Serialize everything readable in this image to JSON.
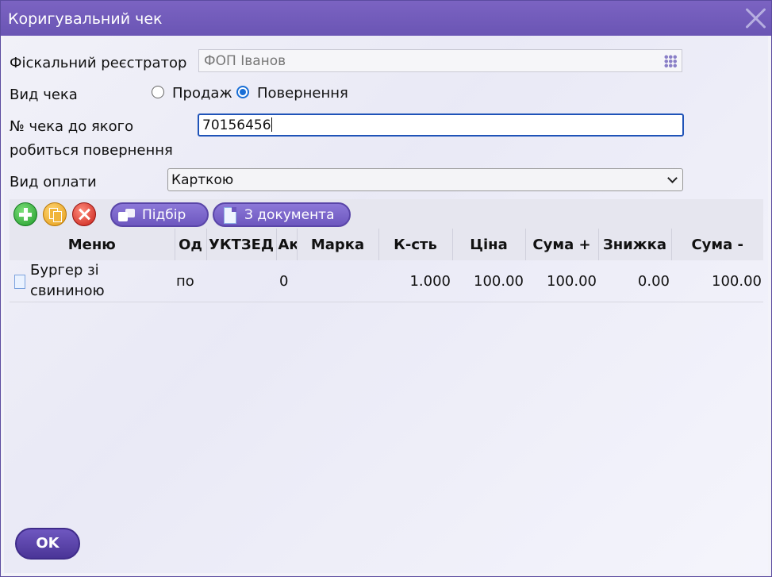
{
  "window": {
    "title": "Коригувальний чек"
  },
  "form": {
    "fiscal_label": "Фіскальний реєстратор",
    "fiscal_value": "ФОП Іванов",
    "receipt_type_label": "Вид чека",
    "option_sale": "Продаж",
    "option_return": "Повернення",
    "selected_option": "Повернення",
    "receipt_no_label_line1": "№ чека до якого",
    "receipt_no_label_line2": "робиться повернення",
    "receipt_no_value": "70156456",
    "payment_label": "Вид оплати",
    "payment_value": "Карткою"
  },
  "toolbar": {
    "add_icon": "add-icon",
    "copy_icon": "copy-icon",
    "delete_icon": "delete-icon",
    "pick_label": "Підбір",
    "from_doc_label": "З документа"
  },
  "table": {
    "columns": [
      "Меню",
      "Од",
      "УКТЗЕД",
      "Ак",
      "Марка",
      "К-сть",
      "Ціна",
      "Сума +",
      "Знижка",
      "Сума -"
    ],
    "rows": [
      {
        "name": "Бургер зі свининою",
        "unit": "по",
        "uktzed": "",
        "excise": "0",
        "brand": "",
        "qty": "1.000",
        "price": "100.00",
        "sum_plus": "100.00",
        "discount": "0.00",
        "sum_minus": "100.00"
      }
    ]
  },
  "footer": {
    "ok_label": "OK"
  },
  "colors": {
    "accent": "#6d57bf",
    "focus_border": "#1f53b8",
    "titlebar": "#7362bd"
  }
}
